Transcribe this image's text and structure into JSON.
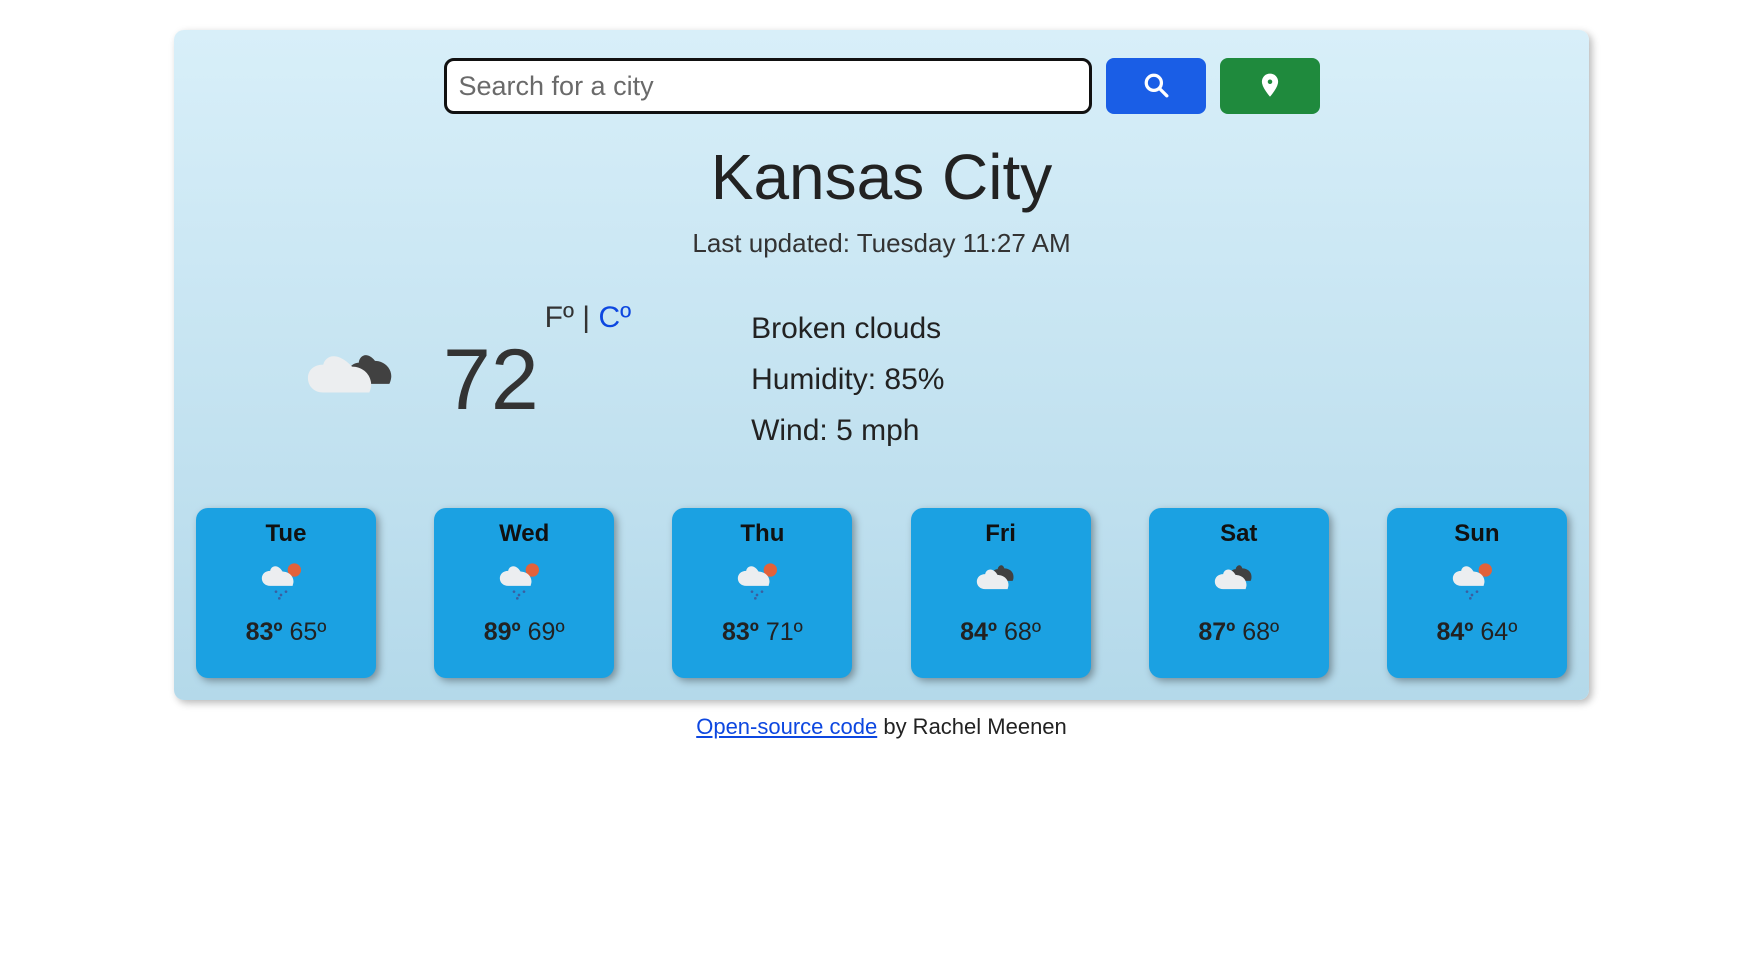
{
  "search": {
    "placeholder": "Search for a city"
  },
  "city": "Kansas City",
  "last_updated_prefix": "Last updated: ",
  "last_updated_time": "Tuesday 11:27 AM",
  "current": {
    "temp": "72",
    "unit_sep": " | ",
    "unit_f": "Fº",
    "unit_c": "Cº",
    "description": "Broken clouds",
    "humidity_label": "Humidity: ",
    "humidity": "85%",
    "wind_label": "Wind: ",
    "wind": "5 mph"
  },
  "forecast": [
    {
      "day": "Tue",
      "high": "83º",
      "low": "65º",
      "icon": "rain-sun"
    },
    {
      "day": "Wed",
      "high": "89º",
      "low": "69º",
      "icon": "rain-sun"
    },
    {
      "day": "Thu",
      "high": "83º",
      "low": "71º",
      "icon": "rain-sun"
    },
    {
      "day": "Fri",
      "high": "84º",
      "low": "68º",
      "icon": "clouds"
    },
    {
      "day": "Sat",
      "high": "87º",
      "low": "68º",
      "icon": "clouds"
    },
    {
      "day": "Sun",
      "high": "84º",
      "low": "64º",
      "icon": "rain-sun"
    }
  ],
  "footer": {
    "link": "Open-source code",
    "by": " by Rachel Meenen"
  }
}
